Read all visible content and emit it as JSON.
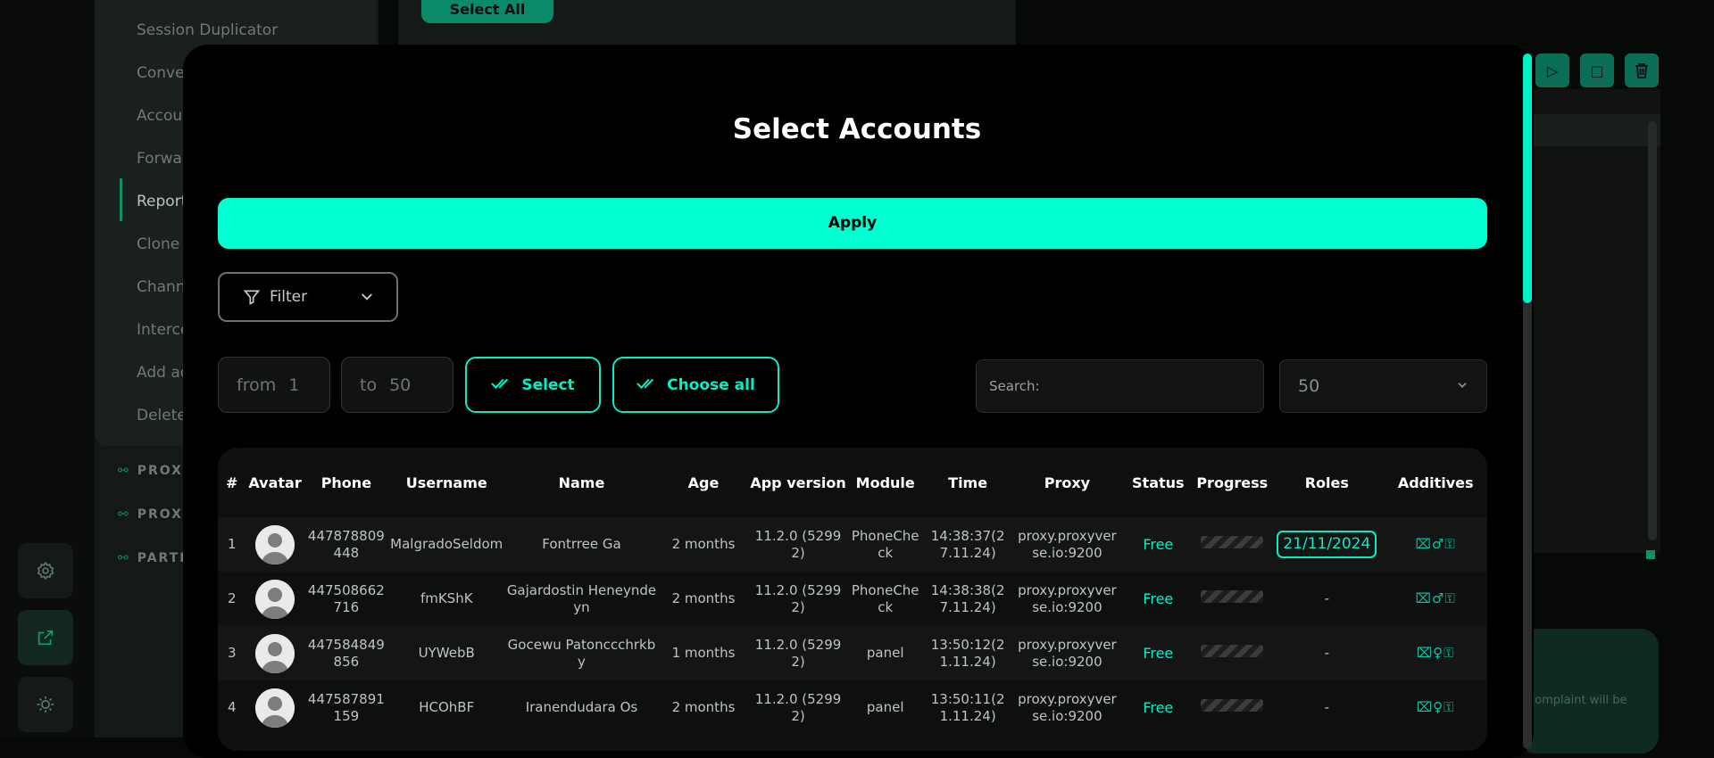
{
  "background": {
    "menu_items": [
      "Session Duplicator",
      "Conve",
      "Accou",
      "Forwa",
      "Report",
      "Clone",
      "Chann",
      "Interce",
      "Add ac",
      "Delete"
    ],
    "active_menu_item": "Report",
    "sections": [
      "PROX",
      "PROX",
      "PARTN"
    ],
    "select_all_label": "Select All",
    "card_text": "complaint will be"
  },
  "modal": {
    "title": "Select Accounts",
    "apply_label": "Apply",
    "filter_label": "Filter",
    "range_from_label": "from",
    "range_from_value": "1",
    "range_to_label": "to",
    "range_to_value": "50",
    "select_label": "Select",
    "choose_all_label": "Choose all",
    "search_placeholder": "Search:",
    "per_page": "50"
  },
  "table": {
    "headers": [
      "#",
      "Avatar",
      "Phone",
      "Username",
      "Name",
      "Age",
      "App version",
      "Module",
      "Time",
      "Proxy",
      "Status",
      "Progress",
      "Roles",
      "Additives"
    ],
    "rows": [
      {
        "num": "1",
        "phone": "447878809448",
        "username": "MalgradoSeldom",
        "name": "Fontrree Ga",
        "age": "2 months",
        "app_version": "11.2.0 (52992)",
        "module": "PhoneCheck",
        "time": "14:38:37(27.11.24)",
        "proxy": "proxy.proxyverse.io:9200",
        "status": "Free",
        "roles": "21/11/2024",
        "additives": "⌧♂⚿"
      },
      {
        "num": "2",
        "phone": "447508662716",
        "username": "fmKShK",
        "name": "Gajardostin Heneyndeyn",
        "age": "2 months",
        "app_version": "11.2.0 (52992)",
        "module": "PhoneCheck",
        "time": "14:38:38(27.11.24)",
        "proxy": "proxy.proxyverse.io:9200",
        "status": "Free",
        "roles": "-",
        "additives": "⌧♂⚿"
      },
      {
        "num": "3",
        "phone": "447584849856",
        "username": "UYWebB",
        "name": "Gocewu Patonccchrkby",
        "age": "1 months",
        "app_version": "11.2.0 (52992)",
        "module": "panel",
        "time": "13:50:12(21.11.24)",
        "proxy": "proxy.proxyverse.io:9200",
        "status": "Free",
        "roles": "-",
        "additives": "⌧♀⚿"
      },
      {
        "num": "4",
        "phone": "447587891159",
        "username": "HCOhBF",
        "name": "Iranendudara Os",
        "age": "2 months",
        "app_version": "11.2.0 (52992)",
        "module": "panel",
        "time": "13:50:11(21.11.24)",
        "proxy": "proxy.proxyverse.io:9200",
        "status": "Free",
        "roles": "-",
        "additives": "⌧♀⚿"
      }
    ]
  },
  "colors": {
    "accent": "#00ffd1",
    "background": "#000000",
    "muted_accent": "#0a8a68"
  }
}
